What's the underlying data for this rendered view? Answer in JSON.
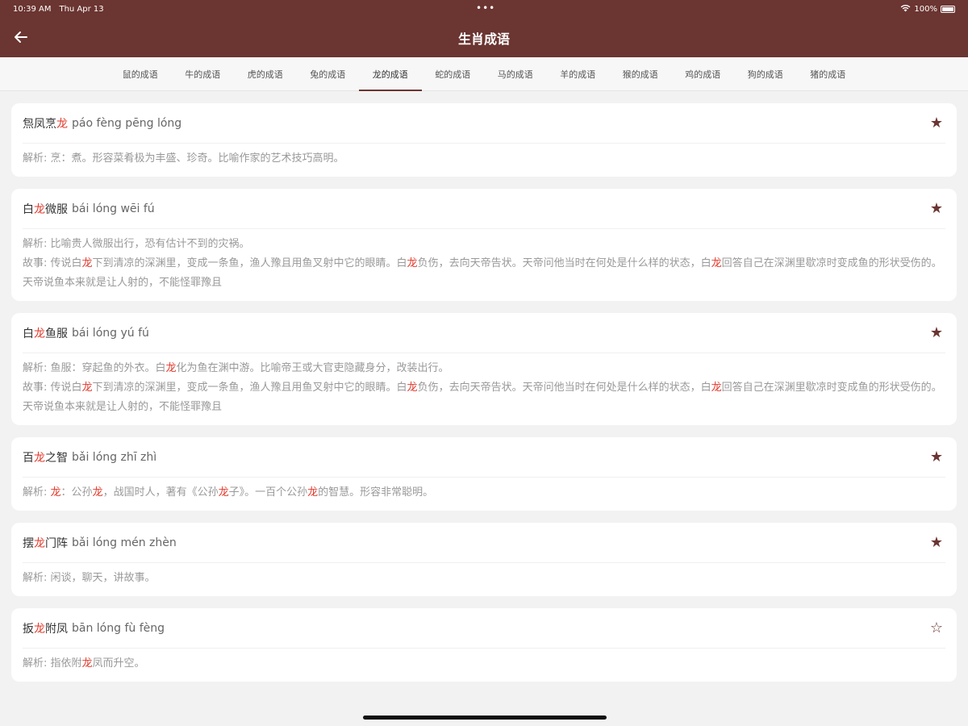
{
  "status": {
    "time": "10:39 AM",
    "date": "Thu Apr 13",
    "battery": "100%"
  },
  "nav": {
    "title": "生肖成语"
  },
  "tabs": [
    {
      "label": "鼠的成语",
      "active": false
    },
    {
      "label": "牛的成语",
      "active": false
    },
    {
      "label": "虎的成语",
      "active": false
    },
    {
      "label": "兔的成语",
      "active": false
    },
    {
      "label": "龙的成语",
      "active": true
    },
    {
      "label": "蛇的成语",
      "active": false
    },
    {
      "label": "马的成语",
      "active": false
    },
    {
      "label": "羊的成语",
      "active": false
    },
    {
      "label": "猴的成语",
      "active": false
    },
    {
      "label": "鸡的成语",
      "active": false
    },
    {
      "label": "狗的成语",
      "active": false
    },
    {
      "label": "猪的成语",
      "active": false
    }
  ],
  "highlight": "龙",
  "colors": {
    "brand": "#6b3531",
    "highlight": "#e03a2c",
    "muted": "#999999"
  },
  "icons": {
    "back": "arrow-left-icon",
    "star_filled": "star-filled-icon",
    "star_empty": "star-outline-icon"
  },
  "entries": [
    {
      "idiom": "炰凤烹龙",
      "pinyin": "páo fèng pēng lóng",
      "favorite": true,
      "lines": [
        "解析: 烹：煮。形容菜肴极为丰盛、珍奇。比喻作家的艺术技巧高明。"
      ]
    },
    {
      "idiom": "白龙微服",
      "pinyin": "bái lóng wēi fú",
      "favorite": true,
      "lines": [
        "解析: 比喻贵人微服出行，恐有估计不到的灾祸。",
        "故事: 传说白龙下到清凉的深渊里，变成一条鱼，渔人豫且用鱼叉射中它的眼睛。白龙负伤，去向天帝告状。天帝问他当时在何处是什么样的状态，白龙回答自己在深渊里歇凉时变成鱼的形状受伤的。天帝说鱼本来就是让人射的，不能怪罪豫且"
      ]
    },
    {
      "idiom": "白龙鱼服",
      "pinyin": "bái lóng yú fú",
      "favorite": true,
      "lines": [
        "解析: 鱼服：穿起鱼的外衣。白龙化为鱼在渊中游。比喻帝王或大官吏隐藏身分，改装出行。",
        "故事: 传说白龙下到清凉的深渊里，变成一条鱼，渔人豫且用鱼叉射中它的眼睛。白龙负伤，去向天帝告状。天帝问他当时在何处是什么样的状态，白龙回答自己在深渊里歇凉时变成鱼的形状受伤的。天帝说鱼本来就是让人射的，不能怪罪豫且"
      ]
    },
    {
      "idiom": "百龙之智",
      "pinyin": "bǎi lóng zhī zhì",
      "favorite": true,
      "lines": [
        "解析: 龙：公孙龙，战国时人，著有《公孙龙子》。一百个公孙龙的智慧。形容非常聪明。"
      ]
    },
    {
      "idiom": "摆龙门阵",
      "pinyin": "bǎi lóng mén zhèn",
      "favorite": true,
      "lines": [
        "解析: 闲谈，聊天，讲故事。"
      ]
    },
    {
      "idiom": "扳龙附凤",
      "pinyin": "bān lóng fù fèng",
      "favorite": false,
      "lines": [
        "解析: 指依附龙凤而升空。"
      ]
    }
  ]
}
